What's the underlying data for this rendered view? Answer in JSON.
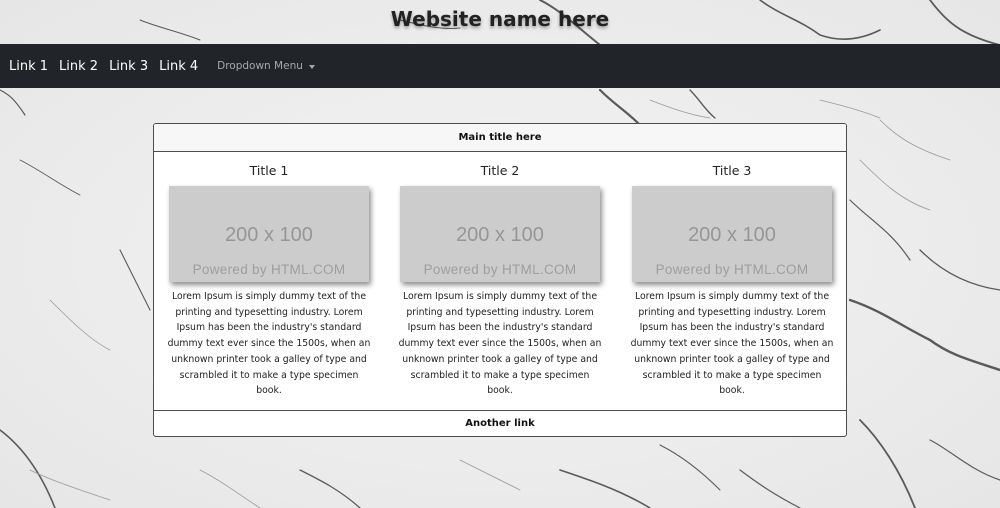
{
  "header": {
    "site_title": "Website name here"
  },
  "navbar": {
    "links": [
      "Link 1",
      "Link 2",
      "Link 3",
      "Link 4"
    ],
    "dropdown_label": "Dropdown Menu",
    "background_color": "#212529"
  },
  "card": {
    "title": "Main title here",
    "columns": [
      {
        "title": "Title 1",
        "image_dims": "200 x 100",
        "image_caption": "Powered by HTML.COM",
        "text": "Lorem Ipsum is simply dummy text of the printing and typesetting industry. Lorem Ipsum has been the industry's standard dummy text ever since the 1500s, when an unknown printer took a galley of type and scrambled it to make a type specimen book."
      },
      {
        "title": "Title 2",
        "image_dims": "200 x 100",
        "image_caption": "Powered by HTML.COM",
        "text": "Lorem Ipsum is simply dummy text of the printing and typesetting industry. Lorem Ipsum has been the industry's standard dummy text ever since the 1500s, when an unknown printer took a galley of type and scrambled it to make a type specimen book."
      },
      {
        "title": "Title 3",
        "image_dims": "200 x 100",
        "image_caption": "Powered by HTML.COM",
        "text": "Lorem Ipsum is simply dummy text of the printing and typesetting industry. Lorem Ipsum has been the industry's standard dummy text ever since the 1500s, when an unknown printer took a galley of type and scrambled it to make a type specimen book."
      }
    ],
    "footer_link": "Another link"
  }
}
